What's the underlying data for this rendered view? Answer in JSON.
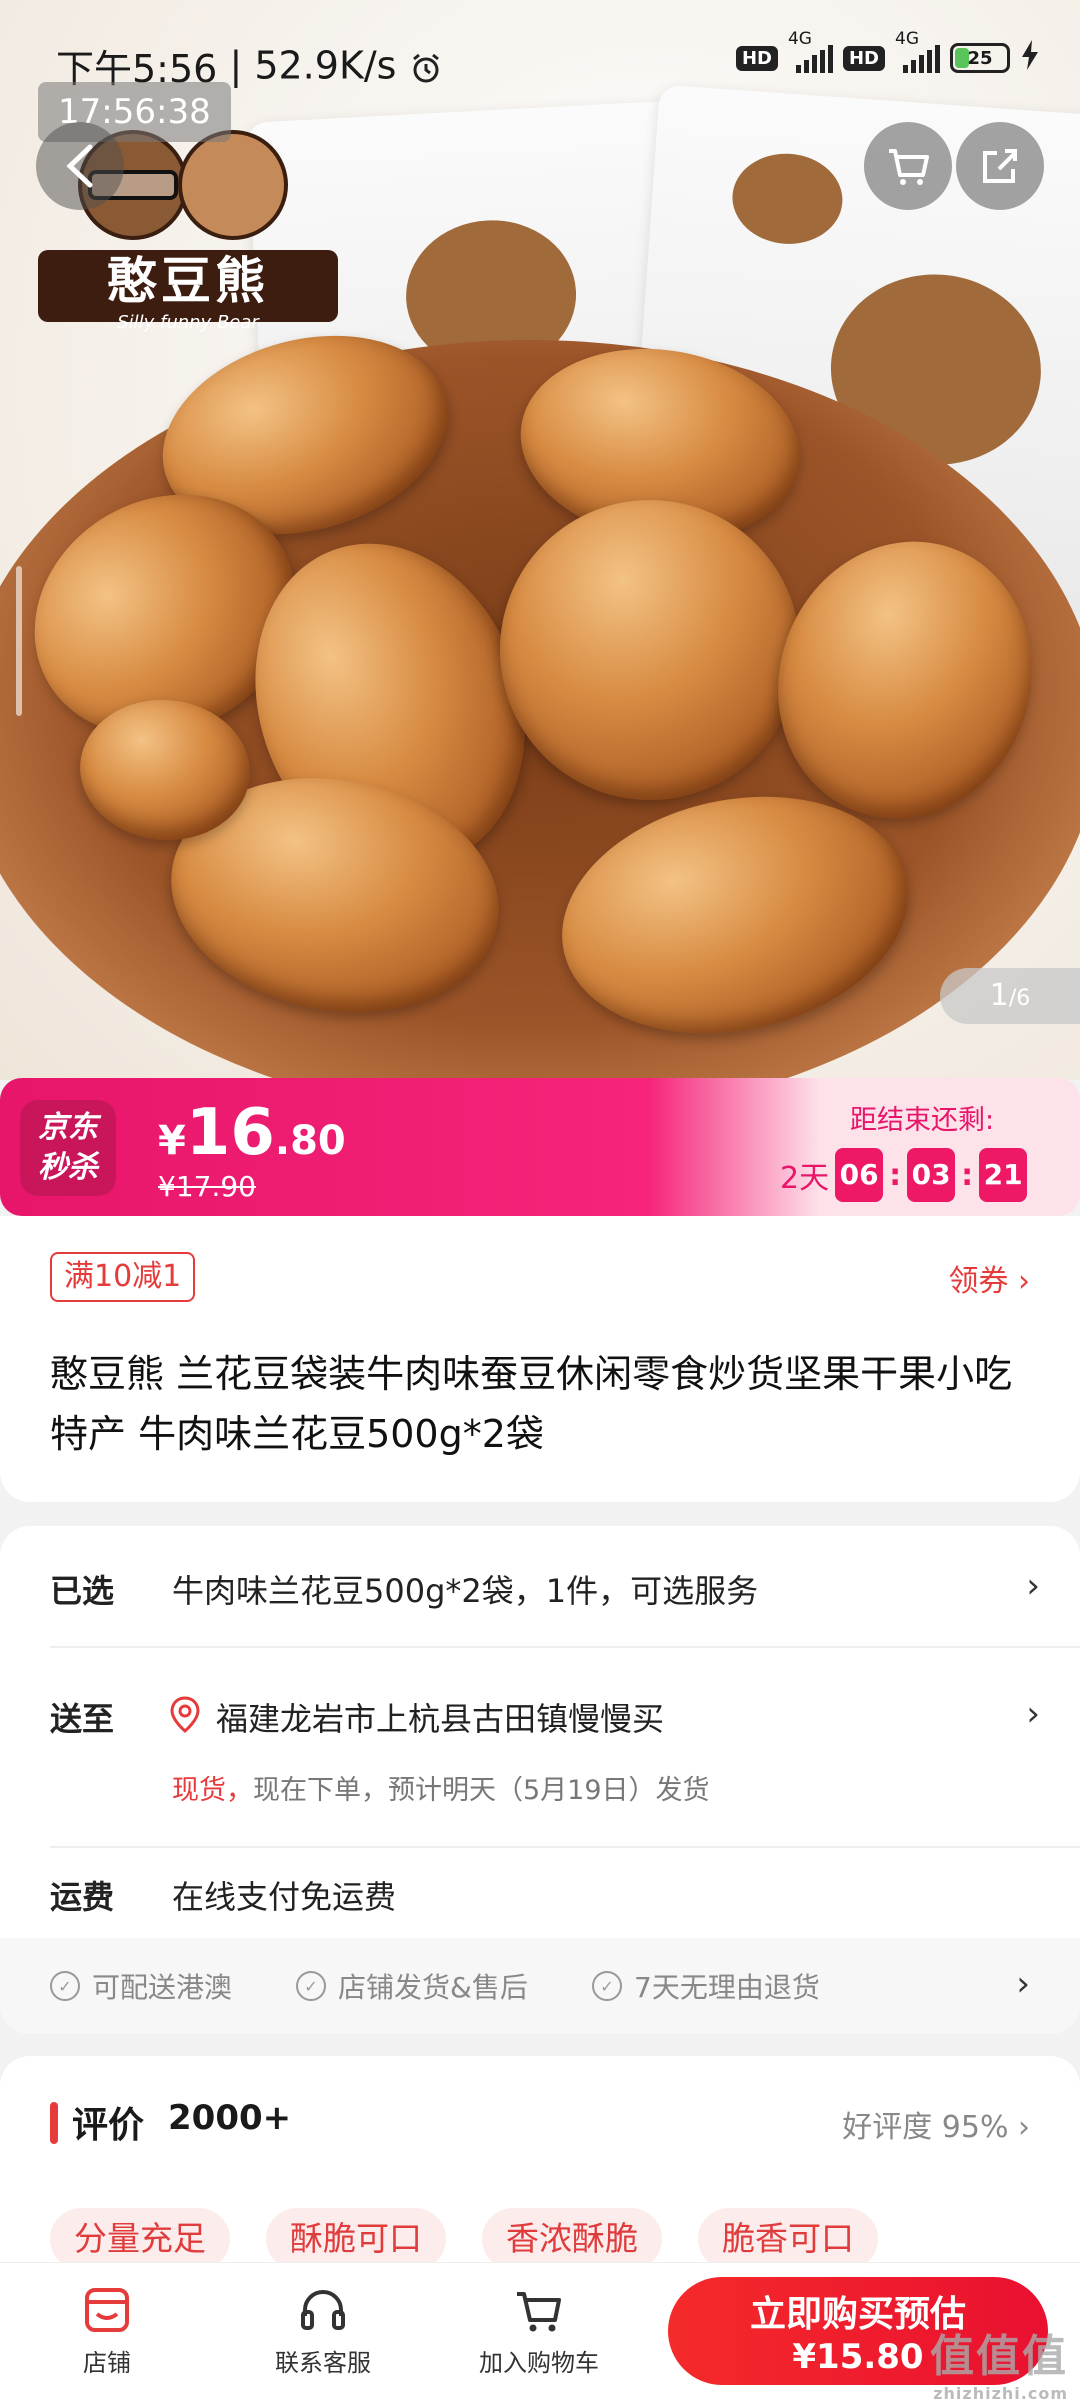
{
  "status": {
    "time": "下午5:56",
    "net_speed": "52.9K/s",
    "hd1": "HD",
    "sig1": "4G",
    "hd2": "HD",
    "sig2": "4G",
    "battery": "25",
    "clock_overlay": "17:56:38"
  },
  "hero": {
    "brand_name": "憨豆熊",
    "brand_sub": "Silly funny Bear",
    "counter_current": "1",
    "counter_total": "/6"
  },
  "flash_sale": {
    "logo_line1": "京东",
    "logo_line2": "秒杀",
    "currency": "¥",
    "price_int": "16",
    "price_dec": ".80",
    "old_price": "¥17.90",
    "ends_label": "距结束还剩:",
    "days": "2天",
    "hours": "06",
    "minutes": "03",
    "seconds": "21",
    "sep": ":"
  },
  "product": {
    "coupon_tag": "满10减1",
    "coupon_link": "领券 ›",
    "title": "憨豆熊 兰花豆袋装牛肉味蚕豆休闲零食炒货坚果干果小吃特产 牛肉味兰花豆500g*2袋"
  },
  "options": {
    "selected_label": "已选",
    "selected_value": "牛肉味兰花豆500g*2袋，1件，可选服务",
    "ship_label": "送至",
    "ship_value": "福建龙岩市上杭县古田镇慢慢买",
    "stock": "现货，",
    "ship_note": "现在下单，预计明天（5月19日）发货",
    "freight_label": "运费",
    "freight_value": "在线支付免运费",
    "chevron": "›"
  },
  "services": [
    "可配送港澳",
    "店铺发货&售后",
    "7天无理由退货"
  ],
  "reviews": {
    "title": "评价",
    "count": "2000+",
    "rate": "好评度 95% ›",
    "tags": [
      "分量充足",
      "酥脆可口",
      "香浓酥脆",
      "脆香可口"
    ]
  },
  "bottom_nav": {
    "shop": "店铺",
    "service": "联系客服",
    "cart": "加入购物车",
    "buy_line1": "立即购买预估",
    "buy_line2": "¥15.80"
  },
  "watermark": {
    "text": "值值值",
    "domain": "zhizhizhi.com"
  },
  "colors": {
    "accent": "#e63b3b",
    "sale_pink": "#ef1866",
    "buy_red": "#f52a2a"
  }
}
